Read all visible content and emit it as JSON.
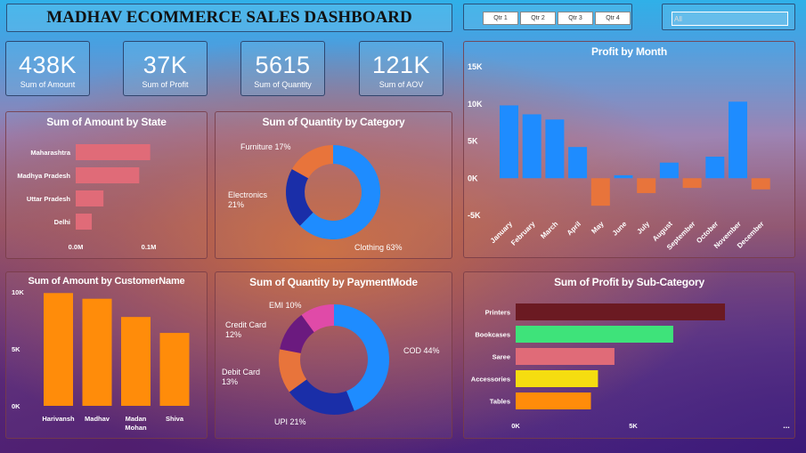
{
  "header": {
    "title": "MADHAV ECOMMERCE SALES DASHBOARD"
  },
  "slicer": {
    "quarters": [
      "Qtr 1",
      "Qtr 2",
      "Qtr 3",
      "Qtr 4"
    ]
  },
  "search": {
    "placeholder": "All"
  },
  "kpis": [
    {
      "value": "438K",
      "label": "Sum of Amount"
    },
    {
      "value": "37K",
      "label": "Sum of Profit"
    },
    {
      "value": "5615",
      "label": "Sum of Quantity"
    },
    {
      "value": "121K",
      "label": "Sum of AOV"
    }
  ],
  "titles": {
    "state": "Sum of Amount by State",
    "category": "Sum of Quantity by Category",
    "month": "Profit by Month",
    "customer": "Sum of Amount by CustomerName",
    "payment": "Sum of Quantity by PaymentMode",
    "subcategory": "Sum of Profit by Sub-Category"
  },
  "more_label": "...",
  "chart_data": [
    {
      "id": "state",
      "type": "bar",
      "orientation": "horizontal",
      "title": "Sum of Amount by State",
      "categories": [
        "Maharashtra",
        "Madhya Pradesh",
        "Uttar Pradesh",
        "Delhi"
      ],
      "values": [
        102000,
        87000,
        38000,
        22000
      ],
      "xticks": [
        {
          "v": 0,
          "label": "0.0M"
        },
        {
          "v": 100000,
          "label": "0.1M"
        }
      ],
      "xlim": [
        0,
        150000
      ],
      "color": "#e06b78"
    },
    {
      "id": "category",
      "type": "pie",
      "donut": true,
      "title": "Sum of Quantity by Category",
      "labels": [
        "Clothing 63%",
        "Electronics 21%",
        "Furniture 17%"
      ],
      "values": [
        63,
        21,
        17
      ],
      "colors": [
        "#1e8cff",
        "#1a2ea8",
        "#e8743b"
      ]
    },
    {
      "id": "month",
      "type": "bar",
      "title": "Profit by Month",
      "categories": [
        "January",
        "February",
        "March",
        "April",
        "May",
        "June",
        "July",
        "August",
        "September",
        "October",
        "November",
        "December"
      ],
      "values": [
        9800,
        8600,
        7900,
        4200,
        -3700,
        400,
        -2000,
        2100,
        -1300,
        2900,
        10300,
        -1500
      ],
      "yticks": [
        {
          "v": 15000,
          "label": "15K"
        },
        {
          "v": 10000,
          "label": "10K"
        },
        {
          "v": 5000,
          "label": "5K"
        },
        {
          "v": 0,
          "label": "0K"
        },
        {
          "v": -5000,
          "label": "-5K"
        }
      ],
      "ylim": [
        -5000,
        15000
      ],
      "colors": {
        "positive": "#1e8cff",
        "negative": "#e8743b"
      }
    },
    {
      "id": "customer",
      "type": "bar",
      "title": "Sum of Amount by CustomerName",
      "categories": [
        "Harivansh",
        "Madhav",
        "Madan Mohan",
        "Shiva"
      ],
      "values": [
        9900,
        9400,
        7800,
        6400
      ],
      "yticks": [
        {
          "v": 10000,
          "label": "10K"
        },
        {
          "v": 5000,
          "label": "5K"
        },
        {
          "v": 0,
          "label": "0K"
        }
      ],
      "ylim": [
        0,
        10000
      ],
      "color": "#ff8c0a"
    },
    {
      "id": "payment",
      "type": "pie",
      "donut": true,
      "title": "Sum of Quantity by PaymentMode",
      "labels": [
        "COD 44%",
        "UPI 21%",
        "Debit Card 13%",
        "Credit Card 12%",
        "EMI 10%"
      ],
      "values": [
        44,
        21,
        13,
        12,
        10
      ],
      "colors": [
        "#1e8cff",
        "#1a2ea8",
        "#e8743b",
        "#6b1a7f",
        "#e04aa8"
      ]
    },
    {
      "id": "subcategory",
      "type": "bar",
      "orientation": "horizontal",
      "title": "Sum of Profit by Sub-Category",
      "categories": [
        "Printers",
        "Bookcases",
        "Saree",
        "Accessories",
        "Tables"
      ],
      "values": [
        8900,
        6700,
        4200,
        3500,
        3200
      ],
      "xticks": [
        {
          "v": 0,
          "label": "0K"
        },
        {
          "v": 5000,
          "label": "5K"
        }
      ],
      "xlim": [
        0,
        10300
      ],
      "colors": [
        "#6b1a22",
        "#3ee37a",
        "#e06b78",
        "#f5dd10",
        "#ff8c0a"
      ]
    }
  ]
}
